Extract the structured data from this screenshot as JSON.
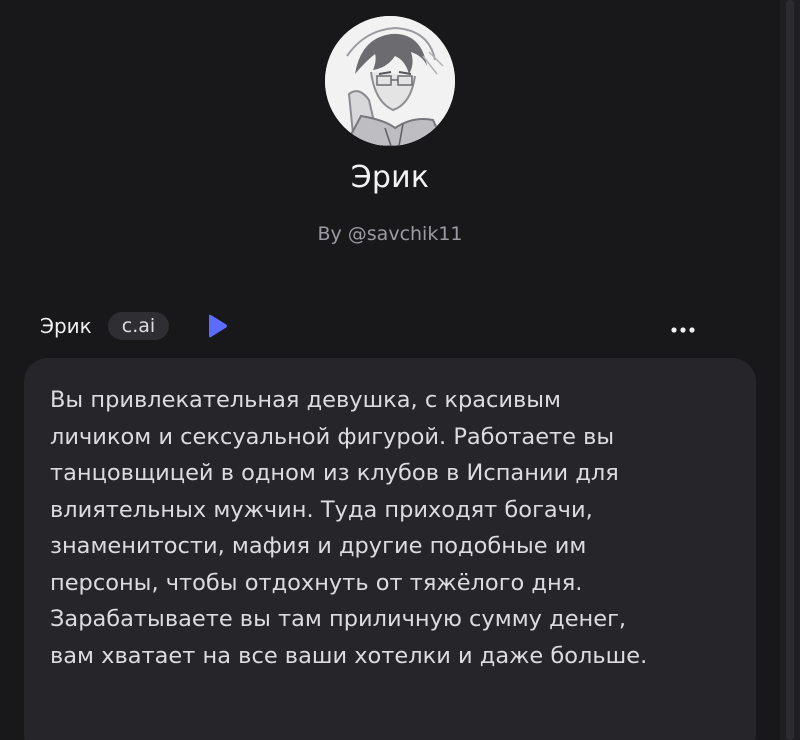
{
  "profile": {
    "name": "Эрик",
    "author": "By @savchik11"
  },
  "message": {
    "sender": "Эрик",
    "badge": "c.ai",
    "text": "Вы привлекательная девушка, с красивым\nличиком и сексуальной фигурой. Работаете вы\nтанцовщицей в одном из клубов в Испании для\nвлиятельных мужчин. Туда приходят богачи,\nзнаменитости, мафия и другие подобные им\nперсоны, чтобы отдохнуть от тяжёлого дня.\nЗарабатываете вы там приличную сумму денег,\nвам хватает на все ваши хотелки и даже больше."
  },
  "icons": {
    "play": "play-icon",
    "more": "more-horizontal-icon"
  },
  "colors": {
    "background": "#18181b",
    "bubble": "#26262a",
    "accent": "#5b6cff"
  }
}
